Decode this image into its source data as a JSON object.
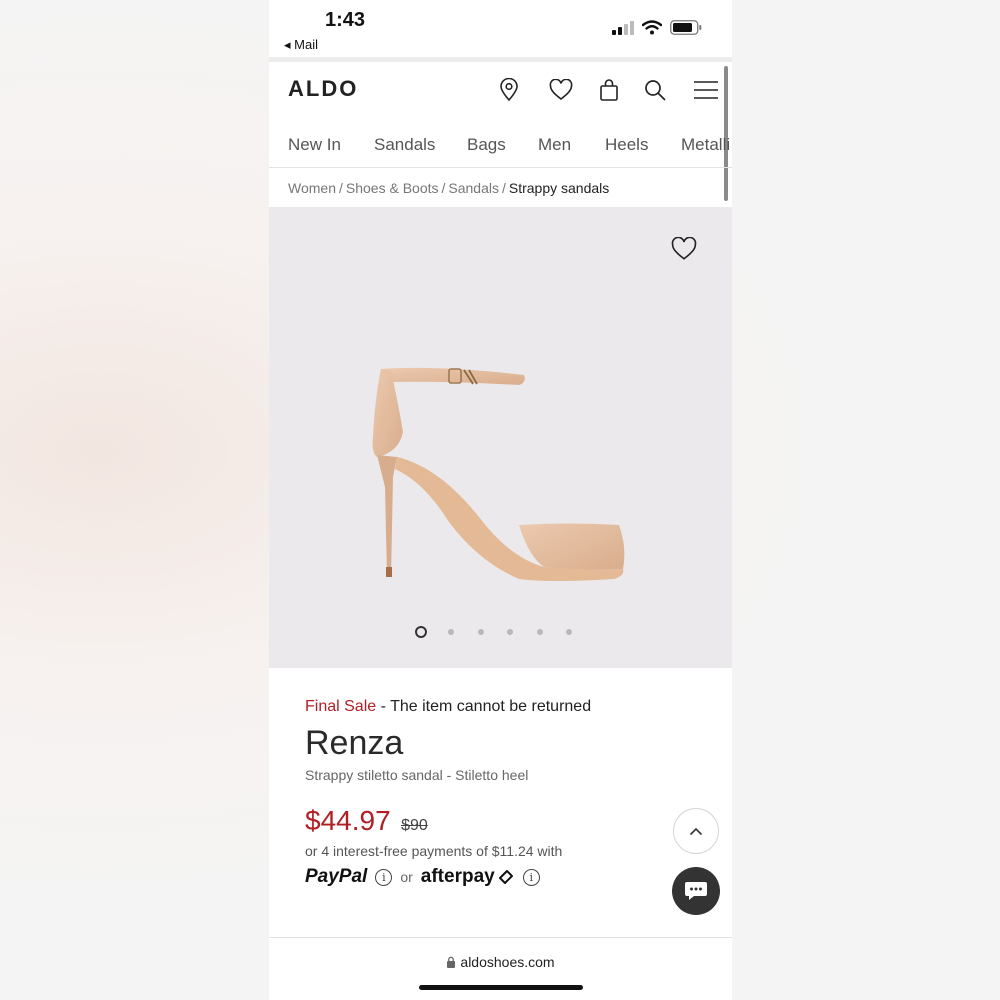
{
  "status_bar": {
    "time": "1:43",
    "back_label": "◂ Mail"
  },
  "header": {
    "logo": "ALDO",
    "icons": [
      "location-pin-icon",
      "heart-icon",
      "shopping-bag-icon",
      "search-icon",
      "menu-icon"
    ]
  },
  "nav": {
    "items": [
      "New In",
      "Sandals",
      "Bags",
      "Men",
      "Heels",
      "Metalli"
    ]
  },
  "breadcrumb": {
    "items": [
      "Women",
      "Shoes & Boots",
      "Sandals"
    ],
    "current": "Strappy sandals"
  },
  "gallery": {
    "image_count": 6,
    "active_index": 0
  },
  "product": {
    "final_sale_label": "Final Sale",
    "final_sale_note": "- The item cannot be returned",
    "name": "Renza",
    "description": "Strappy stiletto sandal - Stiletto heel",
    "price": "$44.97",
    "old_price": "$90",
    "installments": "or 4 interest-free payments of $11.24 with",
    "paypal_label": "PayPal",
    "or_label": "or",
    "afterpay_label": "afterpay"
  },
  "url_bar": {
    "url": "aldoshoes.com"
  },
  "colors": {
    "sale_red": "#b11e23",
    "gallery_bg": "#ebe9eb",
    "chat_button": "#333333"
  }
}
